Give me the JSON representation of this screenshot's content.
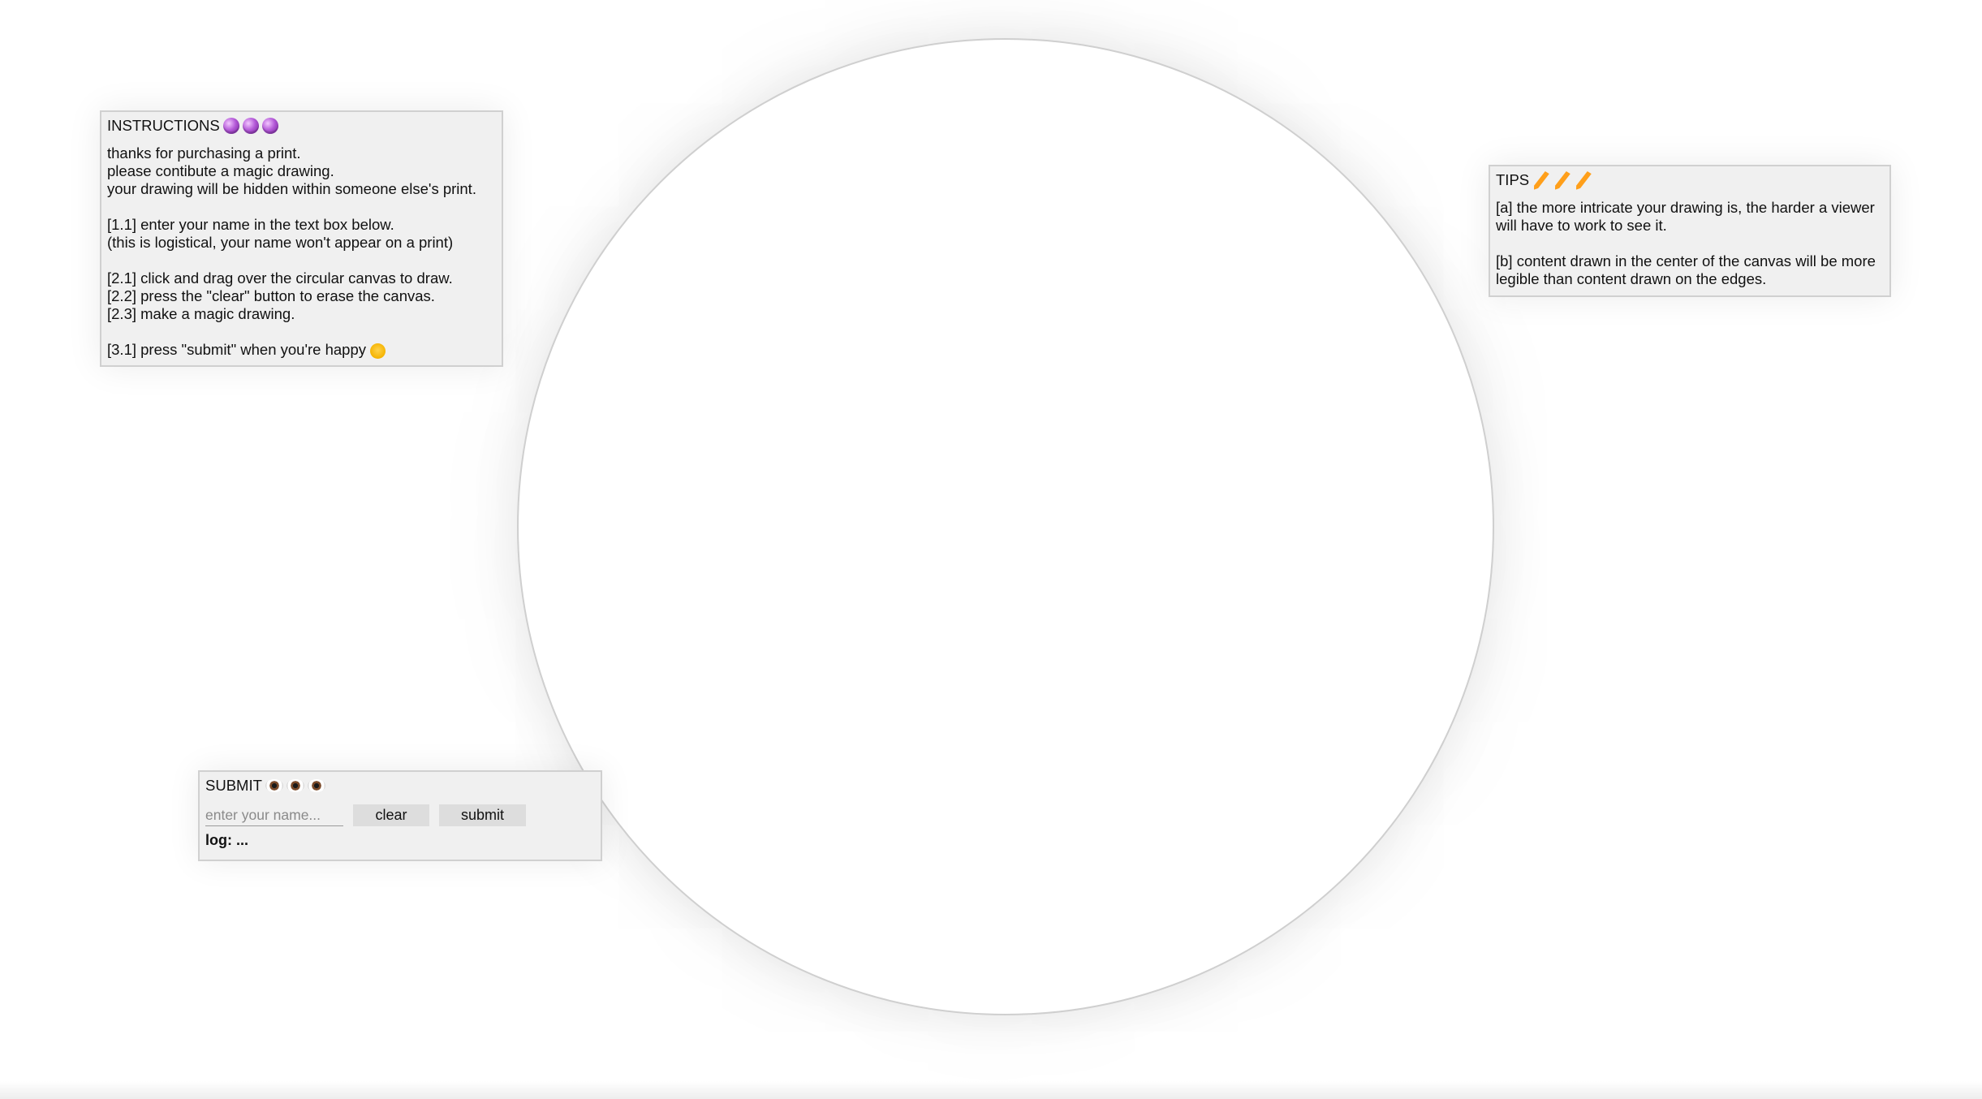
{
  "instructions": {
    "title": "INSTRUCTIONS",
    "title_icons": [
      "crystal-ball-icon",
      "crystal-ball-icon",
      "crystal-ball-icon"
    ],
    "lines": [
      "thanks for purchasing a print.",
      "please contibute a magic drawing.",
      "your drawing will be hidden within someone else's print.",
      "[1.1] enter your name in the text box below.",
      "(this is logistical, your name won't appear on a print)",
      "[2.1] click and drag over the circular canvas to draw.",
      "[2.2] press the \"clear\" button to erase the canvas.",
      "[2.3] make a magic drawing.",
      "[3.1] press \"submit\" when you're happy"
    ],
    "last_line_icon": "smiling-face-icon"
  },
  "tips": {
    "title": "TIPS",
    "title_icons": [
      "pencil-icon",
      "pencil-icon",
      "pencil-icon"
    ],
    "items": [
      "[a] the more intricate your drawing is, the harder a viewer will have to work to see it.",
      "[b] content drawn in the center of the canvas will be more legible than content drawn on the edges."
    ]
  },
  "submit": {
    "title": "SUBMIT",
    "title_icons": [
      "eye-icon",
      "eye-icon",
      "eye-icon"
    ],
    "name_placeholder": "enter your name...",
    "name_value": "",
    "clear_label": "clear",
    "submit_label": "submit",
    "log_text": "log: ..."
  },
  "colors": {
    "panel_background": "#f0f0f0",
    "panel_border": "#d0d0d0",
    "button_background": "#dddddd",
    "canvas_background": "#ffffff",
    "canvas_border": "#cfcfcf"
  }
}
